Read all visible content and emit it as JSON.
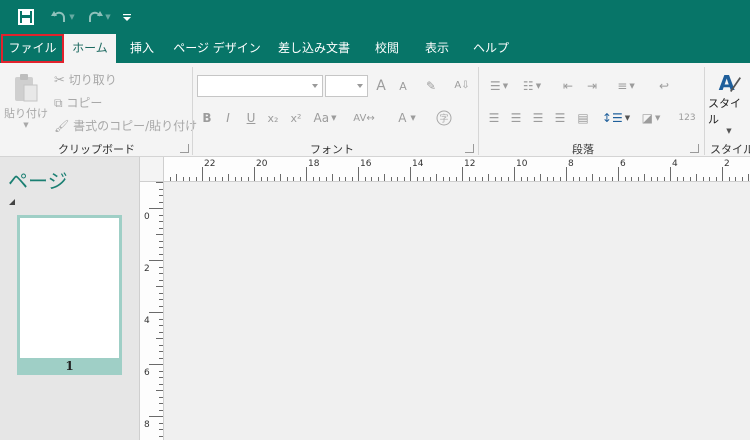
{
  "colors": {
    "accent": "#077568",
    "file_highlight": "#e2222d",
    "pages_title": "#1a7f72",
    "thumb_bg": "#9fcfc6"
  },
  "quick_access": {
    "icons": [
      "save-icon",
      "undo-icon",
      "redo-icon",
      "customize-quick-access-icon"
    ]
  },
  "tabs": [
    {
      "label": "ファイル"
    },
    {
      "label": "ホーム"
    },
    {
      "label": "挿入"
    },
    {
      "label": "ページ デザイン"
    },
    {
      "label": "差し込み文書"
    },
    {
      "label": "校閲"
    },
    {
      "label": "表示"
    },
    {
      "label": "ヘルプ"
    }
  ],
  "ribbon": {
    "clipboard": {
      "label": "クリップボード",
      "paste": "貼り付け",
      "cut": "切り取り",
      "copy": "コピー",
      "format_painter": "書式のコピー/貼り付け"
    },
    "font": {
      "label": "フォント",
      "bold": "B",
      "italic": "I",
      "underline": "U",
      "subscript": "x₂",
      "superscript": "x²",
      "change_case": "Aa",
      "grow_font": "A",
      "shrink_font": "A",
      "font_color": "A"
    },
    "paragraph": {
      "label": "段落",
      "numbering_123": "123"
    },
    "styles": {
      "label": "スタイル",
      "button": "スタイル"
    }
  },
  "pages_pane": {
    "title": "ページ",
    "thumbnails": [
      {
        "number": "1"
      }
    ]
  },
  "ruler": {
    "horizontal_labels": [
      "22",
      "20",
      "18",
      "16",
      "14",
      "12",
      "10",
      "8",
      "6",
      "4",
      "2"
    ],
    "vertical_labels": [
      "0",
      "2",
      "4",
      "6",
      "8"
    ]
  }
}
